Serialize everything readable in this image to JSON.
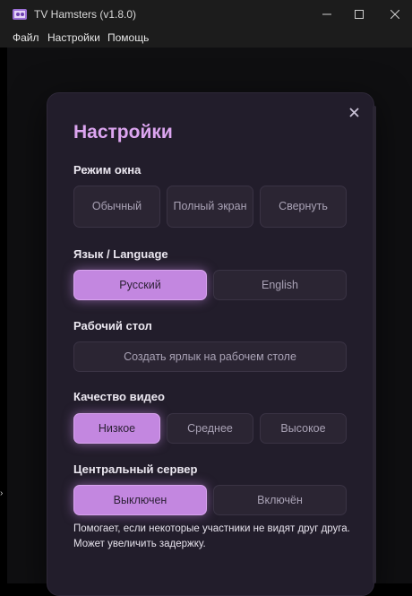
{
  "window": {
    "title": "TV Hamsters (v1.8.0)"
  },
  "menu": {
    "items": [
      "Файл",
      "Настройки",
      "Помощь"
    ]
  },
  "dialog": {
    "title": "Настройки",
    "window_mode": {
      "label": "Режим окна",
      "options": [
        "Обычный",
        "Полный экран",
        "Свернуть"
      ],
      "selected": null
    },
    "language": {
      "label": "Язык / Language",
      "options": [
        "Русский",
        "English"
      ],
      "selected": "Русский"
    },
    "desktop": {
      "label": "Рабочий стол",
      "shortcut_button": "Создать ярлык на рабочем столе"
    },
    "video_quality": {
      "label": "Качество видео",
      "options": [
        "Низкое",
        "Среднее",
        "Высокое"
      ],
      "selected": "Низкое"
    },
    "central_server": {
      "label": "Центральный сервер",
      "options": [
        "Выключен",
        "Включён"
      ],
      "selected": "Выключен",
      "hint": "Помогает, если некоторые участники не видят друг друга. Может увеличить задержку."
    }
  },
  "colors": {
    "accent": "#c387e0",
    "title": "#dca5f0",
    "dialog_bg": "#221d2b"
  },
  "icons": [
    "app-icon",
    "minimize-icon",
    "maximize-icon",
    "close-icon",
    "dialog-close-icon"
  ]
}
